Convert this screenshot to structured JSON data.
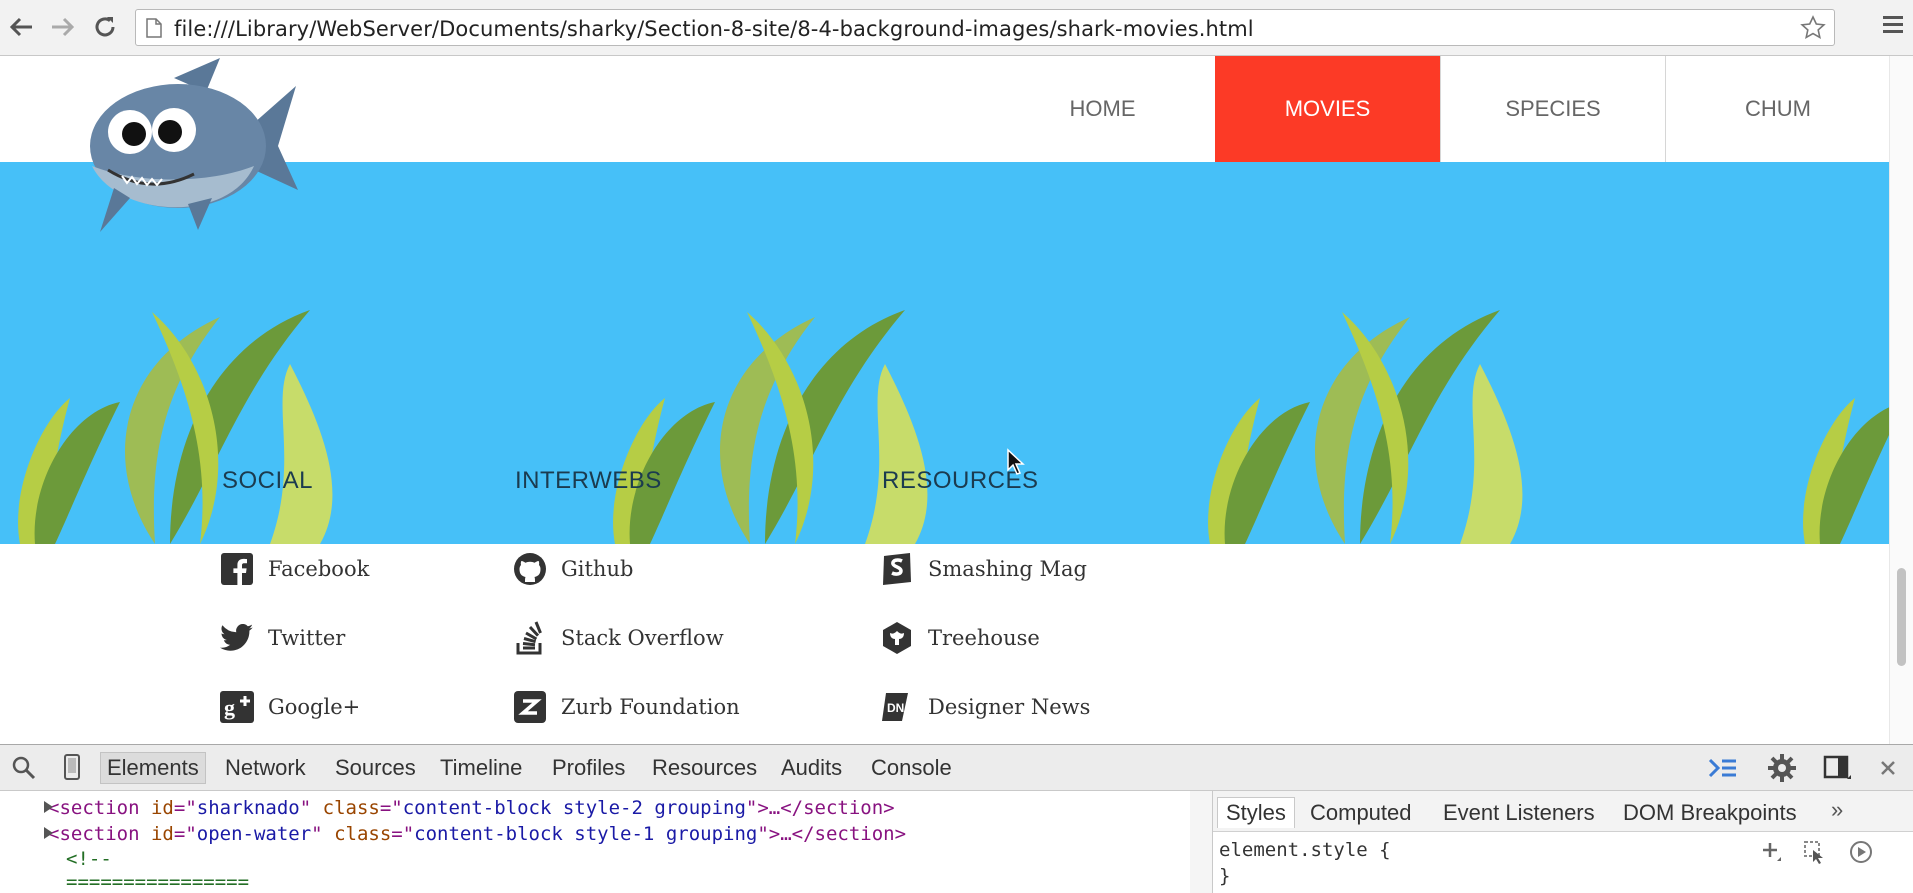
{
  "browser": {
    "url": "file:///Library/WebServer/Documents/sharky/Section-8-site/8-4-background-images/shark-movies.html"
  },
  "nav": {
    "items": [
      {
        "label": "HOME",
        "active": false
      },
      {
        "label": "MOVIES",
        "active": true
      },
      {
        "label": "SPECIES",
        "active": false
      },
      {
        "label": "CHUM",
        "active": false
      }
    ]
  },
  "footer": {
    "columns": [
      {
        "heading": "SOCIAL",
        "links": [
          {
            "label": "Facebook",
            "icon": "facebook-icon"
          },
          {
            "label": "Twitter",
            "icon": "twitter-icon"
          },
          {
            "label": "Google+",
            "icon": "google-plus-icon"
          }
        ]
      },
      {
        "heading": "INTERWEBS",
        "links": [
          {
            "label": "Github",
            "icon": "github-icon"
          },
          {
            "label": "Stack Overflow",
            "icon": "stack-overflow-icon"
          },
          {
            "label": "Zurb Foundation",
            "icon": "zurb-icon"
          }
        ]
      },
      {
        "heading": "RESOURCES",
        "links": [
          {
            "label": "Smashing Mag",
            "icon": "smashing-mag-icon"
          },
          {
            "label": "Treehouse",
            "icon": "treehouse-icon"
          },
          {
            "label": "Designer News",
            "icon": "designer-news-icon"
          }
        ]
      }
    ]
  },
  "devtools": {
    "tabs": [
      "Elements",
      "Network",
      "Sources",
      "Timeline",
      "Profiles",
      "Resources",
      "Audits",
      "Console"
    ],
    "selected_tab": "Elements",
    "code_lines": [
      {
        "tag": "section",
        "id": "sharknado",
        "class": "content-block style-2 grouping"
      },
      {
        "tag": "section",
        "id": "open-water",
        "class": "content-block style-1 grouping"
      }
    ],
    "comment_open": "<!--",
    "comment_rule": "================",
    "sidebar_tabs": [
      "Styles",
      "Computed",
      "Event Listeners",
      "DOM Breakpoints"
    ],
    "element_style_open": "element.style {",
    "element_style_close": "}"
  },
  "colors": {
    "active_nav": "#fc3a26",
    "hero_bg": "#46c0f8",
    "seaweed_dark": "#6c9a3a",
    "seaweed_light": "#b6cd45"
  }
}
